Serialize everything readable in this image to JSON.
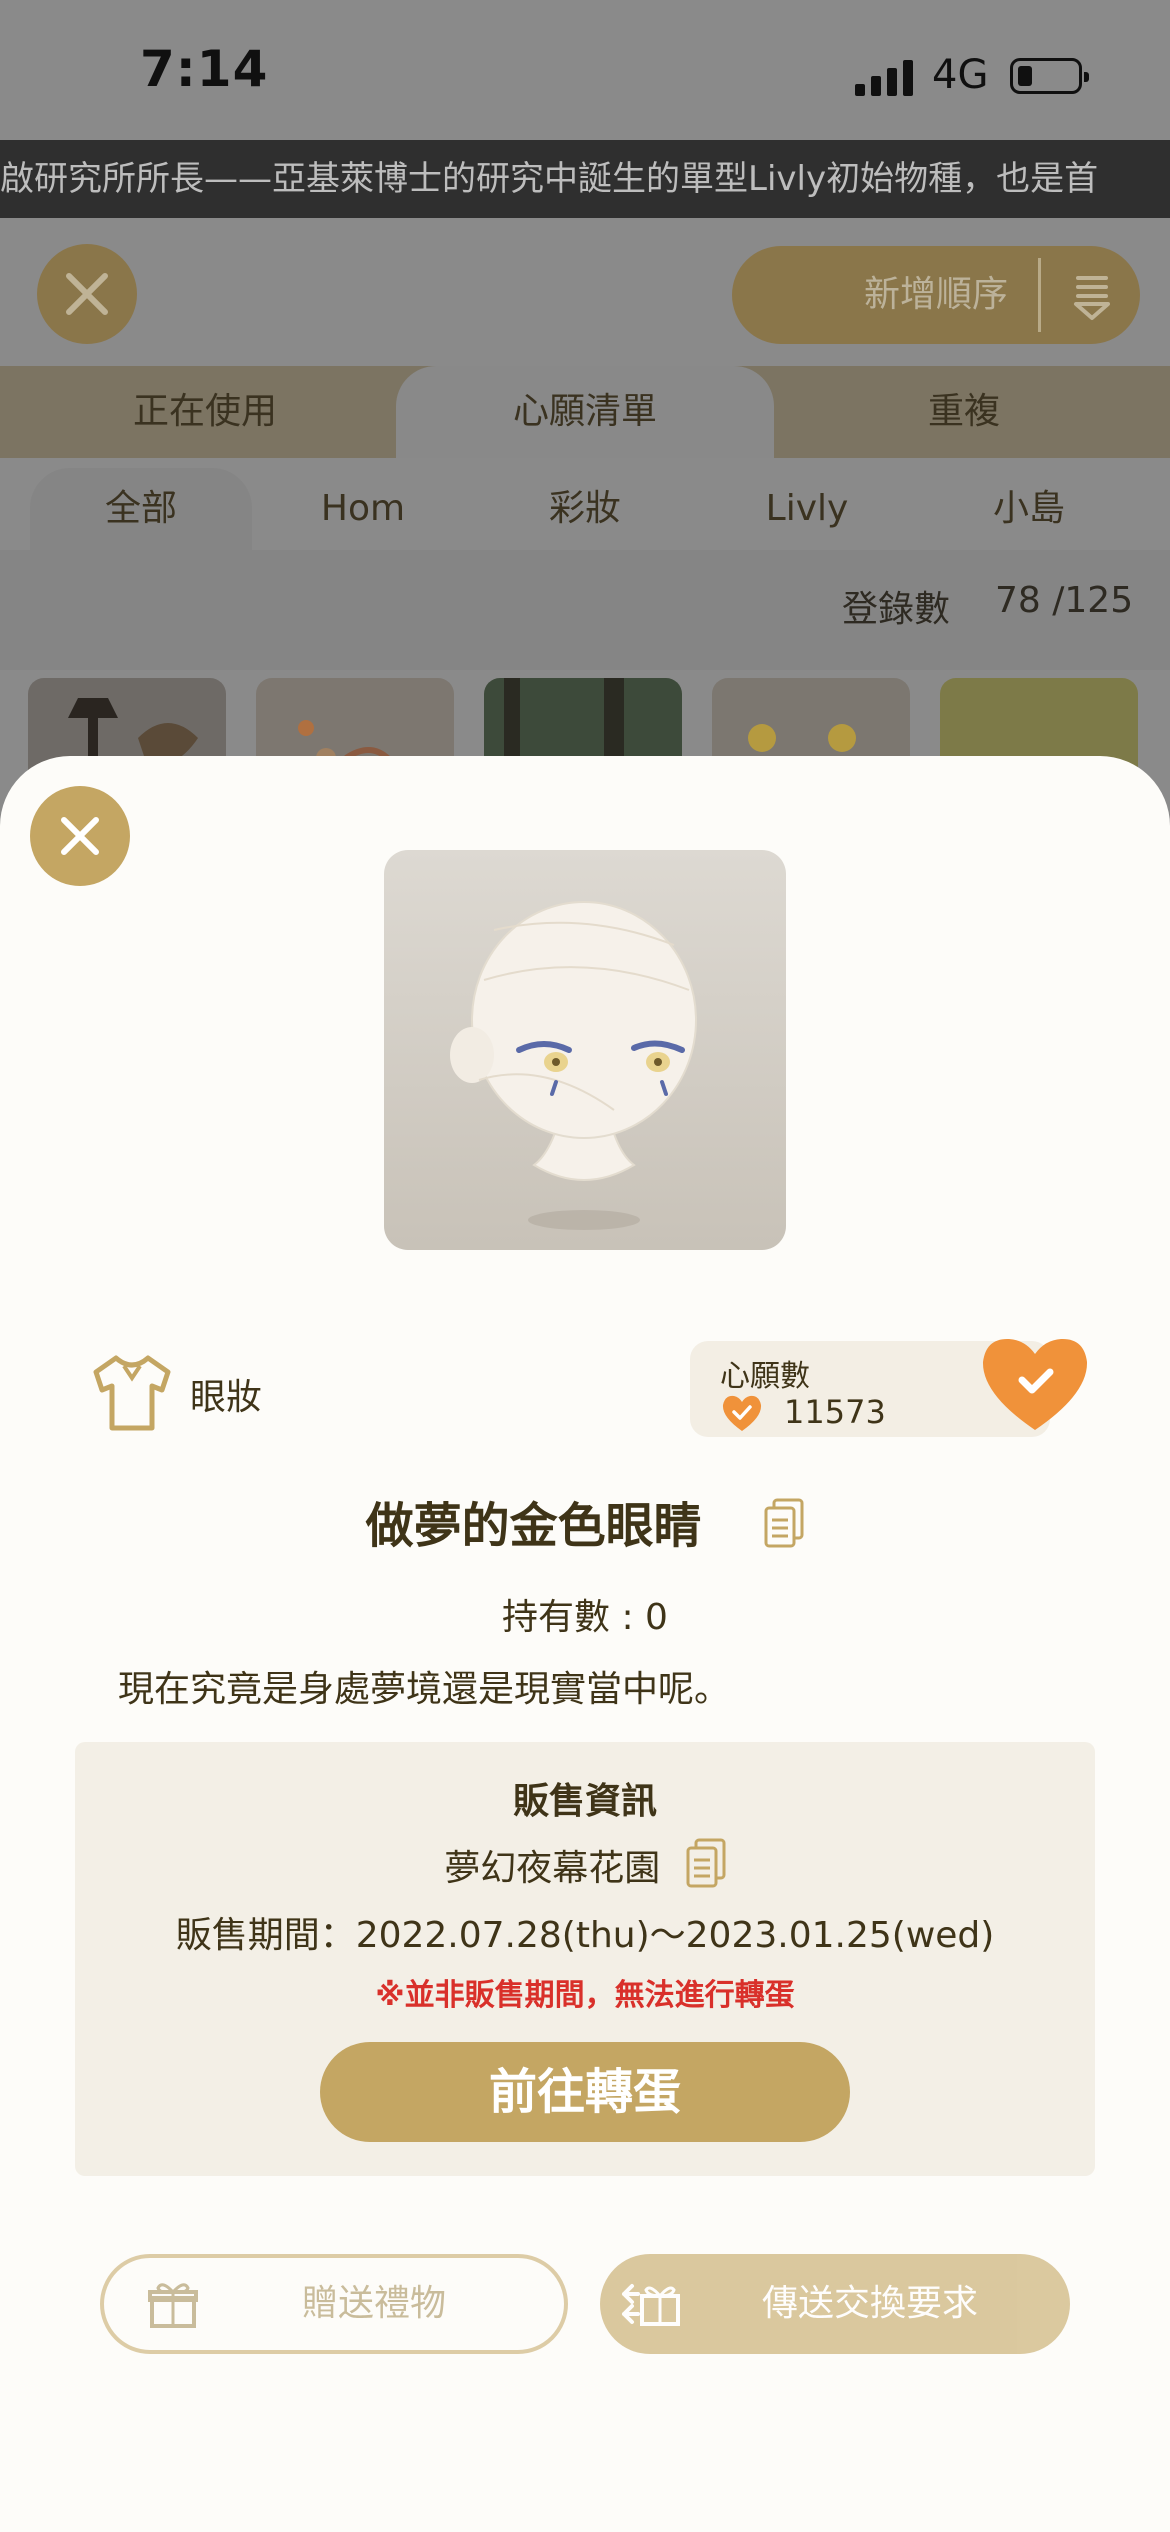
{
  "status_bar": {
    "time": "7:14",
    "network": "4G"
  },
  "marquee_text": "啟研究所所長——亞基萊博士的研究中誕生的單型Livly初始物種，也是首",
  "toolbar": {
    "sort_label": "新增順序"
  },
  "main_tabs": [
    {
      "label": "正在使用",
      "active": false
    },
    {
      "label": "心願清單",
      "active": true
    },
    {
      "label": "重複",
      "active": false
    }
  ],
  "category_tabs": [
    {
      "label": "全部",
      "active": true
    },
    {
      "label": "Hom",
      "active": false
    },
    {
      "label": "彩妝",
      "active": false
    },
    {
      "label": "Livly",
      "active": false
    },
    {
      "label": "小島",
      "active": false
    }
  ],
  "registration": {
    "label": "登錄數",
    "value": "78 /125"
  },
  "item": {
    "category_icon": "shirt-icon",
    "category": "眼妝",
    "wish_label": "心願數",
    "wish_count": "11573",
    "name": "做夢的金色眼睛",
    "owned": "持有數 : 0",
    "description": "現在究竟是身處夢境還是現實當中呢。"
  },
  "sale_info": {
    "title": "販售資訊",
    "gacha_name": "夢幻夜幕花園",
    "period": "販售期間：2022.07.28(thu)～2023.01.25(wed)",
    "warning": "※並非販售期間，無法進行轉蛋",
    "goto_button": "前往轉蛋"
  },
  "actions": {
    "gift": "贈送禮物",
    "trade": "傳送交換要求"
  },
  "colors": {
    "accent_gold": "#c4a663",
    "heart_orange": "#f0923a",
    "warning_red": "#d9302a",
    "text_brown": "#3f3418"
  }
}
